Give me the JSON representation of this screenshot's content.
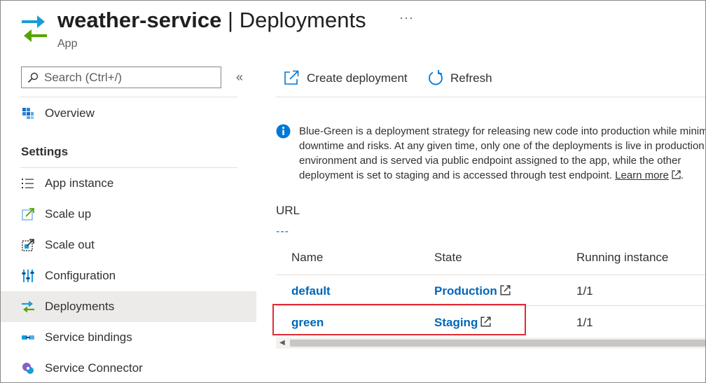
{
  "header": {
    "app_name": "weather-service",
    "separator": "|",
    "page": "Deployments",
    "subtitle": "App",
    "more": "···"
  },
  "sidebar": {
    "search": {
      "placeholder": "Search (Ctrl+/)"
    },
    "collapse": "«",
    "overview": {
      "label": "Overview",
      "icon": "overview-icon"
    },
    "section_title": "Settings",
    "items": [
      {
        "label": "App instance",
        "icon": "list-icon"
      },
      {
        "label": "Scale up",
        "icon": "scale-up-icon"
      },
      {
        "label": "Scale out",
        "icon": "scale-out-icon"
      },
      {
        "label": "Configuration",
        "icon": "configuration-icon"
      },
      {
        "label": "Deployments",
        "icon": "deployments-icon",
        "active": true
      },
      {
        "label": "Service bindings",
        "icon": "service-bindings-icon"
      },
      {
        "label": "Service Connector",
        "icon": "service-connector-icon"
      }
    ]
  },
  "toolbar": {
    "create_label": "Create deployment",
    "refresh_label": "Refresh"
  },
  "info": {
    "text": "Blue-Green is a deployment strategy for releasing new code into production while minimizing downtime and risks. At any given time, only one of the deployments is live in production environment and is served via public endpoint assigned to the app, while the other deployment is set to staging and is accessed through test endpoint.",
    "link": "Learn more",
    "end": "."
  },
  "url": {
    "label": "URL",
    "value": "---"
  },
  "table": {
    "columns": [
      "Name",
      "State",
      "Running instance"
    ],
    "rows": [
      {
        "name": "default",
        "state": "Production",
        "instances": "1/1"
      },
      {
        "name": "green",
        "state": "Staging",
        "instances": "1/1"
      }
    ]
  },
  "colors": {
    "accent": "#0078d4",
    "link": "#0067b8",
    "highlight": "#e02b35",
    "active_bg": "#edebe9"
  }
}
